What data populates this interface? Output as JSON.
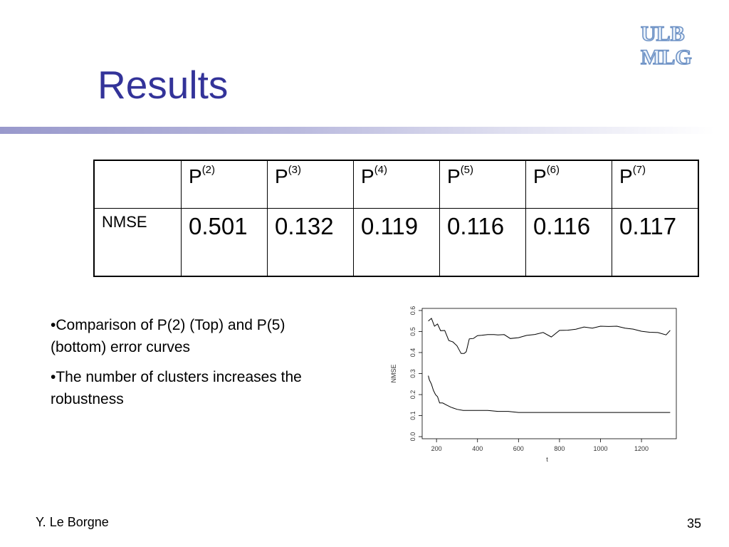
{
  "slide": {
    "title": "Results",
    "logo_text": [
      "ULB",
      "MLG"
    ],
    "footer_author": "Y. Le Borgne",
    "page_number": "35"
  },
  "table": {
    "columns": [
      {
        "base": "P",
        "sup": "(2)"
      },
      {
        "base": "P",
        "sup": "(3)"
      },
      {
        "base": "P",
        "sup": "(4)"
      },
      {
        "base": "P",
        "sup": "(5)"
      },
      {
        "base": "P",
        "sup": "(6)"
      },
      {
        "base": "P",
        "sup": "(7)"
      }
    ],
    "row_label": "NMSE",
    "values": [
      "0.501",
      "0.132",
      "0.119",
      "0.116",
      "0.116",
      "0.117"
    ]
  },
  "bullets": [
    "•Comparison of P(2) (Top) and P(5) (bottom) error curves",
    "•The number of clusters increases the robustness"
  ],
  "chart_data": {
    "type": "line",
    "xlabel": "t",
    "ylabel": "NMSE",
    "xlim": [
      130,
      1370
    ],
    "ylim": [
      -0.01,
      0.61
    ],
    "xticks": [
      200,
      400,
      600,
      800,
      1000,
      1200
    ],
    "xtick_labels": [
      "200",
      "400",
      "600",
      "800",
      "1000",
      "1200"
    ],
    "yticks": [
      0.0,
      0.1,
      0.2,
      0.3,
      0.4,
      0.5,
      0.6
    ],
    "ytick_labels": [
      "0.0",
      "0.1",
      "0.2",
      "0.3",
      "0.4",
      "0.5",
      "0.6"
    ],
    "grid": false,
    "series": [
      {
        "color": "#000000",
        "x": [
          160,
          175,
          190,
          205,
          220,
          240,
          260,
          280,
          300,
          320,
          335,
          345,
          360,
          380,
          400,
          420,
          450,
          480,
          500,
          530,
          560,
          600,
          640,
          680,
          720,
          760,
          800,
          840,
          880,
          920,
          960,
          1000,
          1040,
          1080,
          1120,
          1160,
          1200,
          1240,
          1280,
          1320,
          1340
        ],
        "y": [
          0.55,
          0.56,
          0.53,
          0.53,
          0.51,
          0.5,
          0.46,
          0.45,
          0.43,
          0.4,
          0.39,
          0.41,
          0.46,
          0.47,
          0.48,
          0.48,
          0.49,
          0.48,
          0.49,
          0.48,
          0.47,
          0.47,
          0.48,
          0.49,
          0.49,
          0.48,
          0.5,
          0.51,
          0.51,
          0.52,
          0.52,
          0.52,
          0.53,
          0.52,
          0.52,
          0.51,
          0.5,
          0.5,
          0.49,
          0.49,
          0.5
        ]
      },
      {
        "color": "#000000",
        "x": [
          160,
          165,
          175,
          185,
          195,
          205,
          215,
          230,
          250,
          270,
          300,
          330,
          360,
          400,
          450,
          500,
          550,
          600,
          700,
          800,
          900,
          1000,
          1100,
          1200,
          1300,
          1340
        ],
        "y": [
          0.29,
          0.27,
          0.25,
          0.22,
          0.2,
          0.19,
          0.16,
          0.16,
          0.15,
          0.14,
          0.13,
          0.125,
          0.125,
          0.125,
          0.125,
          0.12,
          0.12,
          0.115,
          0.115,
          0.115,
          0.115,
          0.115,
          0.115,
          0.115,
          0.115,
          0.115
        ]
      }
    ]
  }
}
